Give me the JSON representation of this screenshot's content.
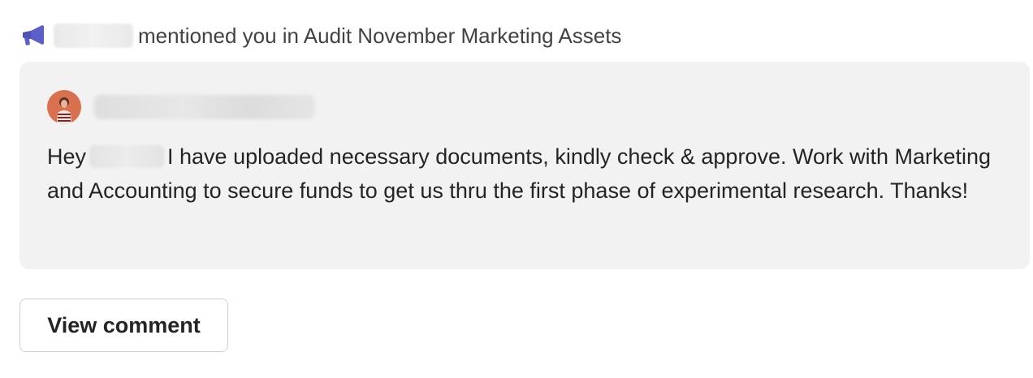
{
  "notification": {
    "icon": "megaphone-icon",
    "icon_color": "#5b5fc7",
    "header_text": "mentioned you in Audit November Marketing Assets"
  },
  "card": {
    "background": "#f2f2f2",
    "avatar": "avatar-icon",
    "message_before": "Hey",
    "message_after": "I have uploaded necessary documents, kindly check & approve. Work with Marketing and Accounting to secure funds to get us thru the first phase of experimental research. Thanks!"
  },
  "actions": {
    "view_comment_label": "View comment"
  }
}
